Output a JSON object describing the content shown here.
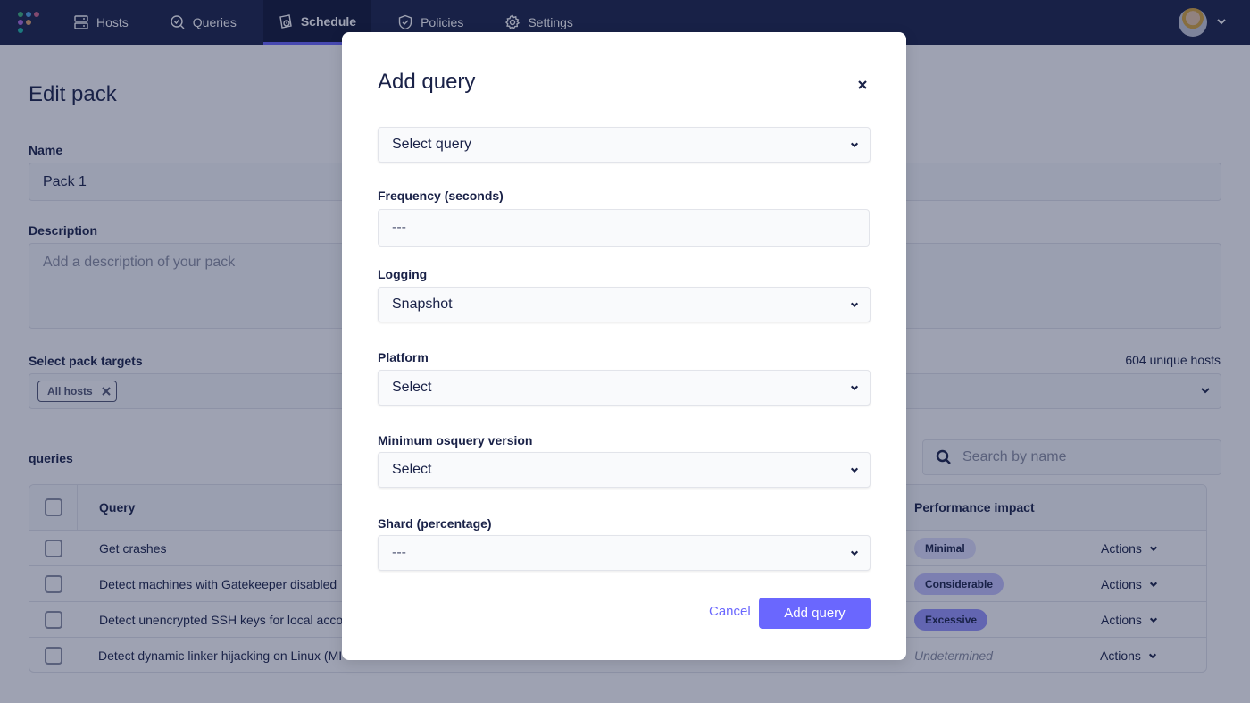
{
  "nav": {
    "items": [
      {
        "label": "Hosts",
        "icon": "hosts-icon",
        "active": false
      },
      {
        "label": "Queries",
        "icon": "queries-icon",
        "active": false
      },
      {
        "label": "Schedule",
        "icon": "schedule-icon",
        "active": true
      },
      {
        "label": "Policies",
        "icon": "policies-icon",
        "active": false
      },
      {
        "label": "Settings",
        "icon": "settings-icon",
        "active": false
      }
    ],
    "logo_colors": [
      "#3db67b",
      "#4fa6e6",
      "#ae6ddf",
      "#d0678c",
      "#9f6fd3",
      "#e0a46b",
      "#1fb8a6"
    ]
  },
  "page": {
    "title": "Edit pack",
    "name_label": "Name",
    "name_value": "Pack 1",
    "description_label": "Description",
    "description_placeholder": "Add a description of your pack",
    "targets_label": "Select pack targets",
    "targets_count": "604 unique hosts",
    "target_chip": "All hosts",
    "queries_heading": "queries",
    "search_placeholder": "Search by name"
  },
  "table": {
    "columns": [
      "Query",
      "Performance impact"
    ],
    "rows": [
      {
        "query": "Get crashes",
        "impact": "Minimal",
        "impact_color": "#e1e1fe",
        "action": "Actions"
      },
      {
        "query": "Detect machines with Gatekeeper disabled",
        "impact": "Considerable",
        "impact_color": "#c4c3fe",
        "action": "Actions"
      },
      {
        "query": "Detect unencrypted SSH keys for local acco",
        "impact": "Excessive",
        "impact_color": "#9896fe",
        "action": "Actions"
      },
      {
        "query": "Detect dynamic linker hijacking on Linux (MI",
        "impact": "Undetermined",
        "impact_color": "",
        "action": "Actions"
      }
    ]
  },
  "modal": {
    "title": "Add query",
    "query_select": "Select query",
    "frequency_label": "Frequency (seconds)",
    "frequency_placeholder": "---",
    "logging_label": "Logging",
    "logging_value": "Snapshot",
    "platform_label": "Platform",
    "platform_value": "Select",
    "min_version_label": "Minimum osquery version",
    "min_version_value": "Select",
    "shard_label": "Shard (percentage)",
    "shard_value": "---",
    "cancel": "Cancel",
    "submit": "Add query",
    "accent": "#6a67fe"
  }
}
